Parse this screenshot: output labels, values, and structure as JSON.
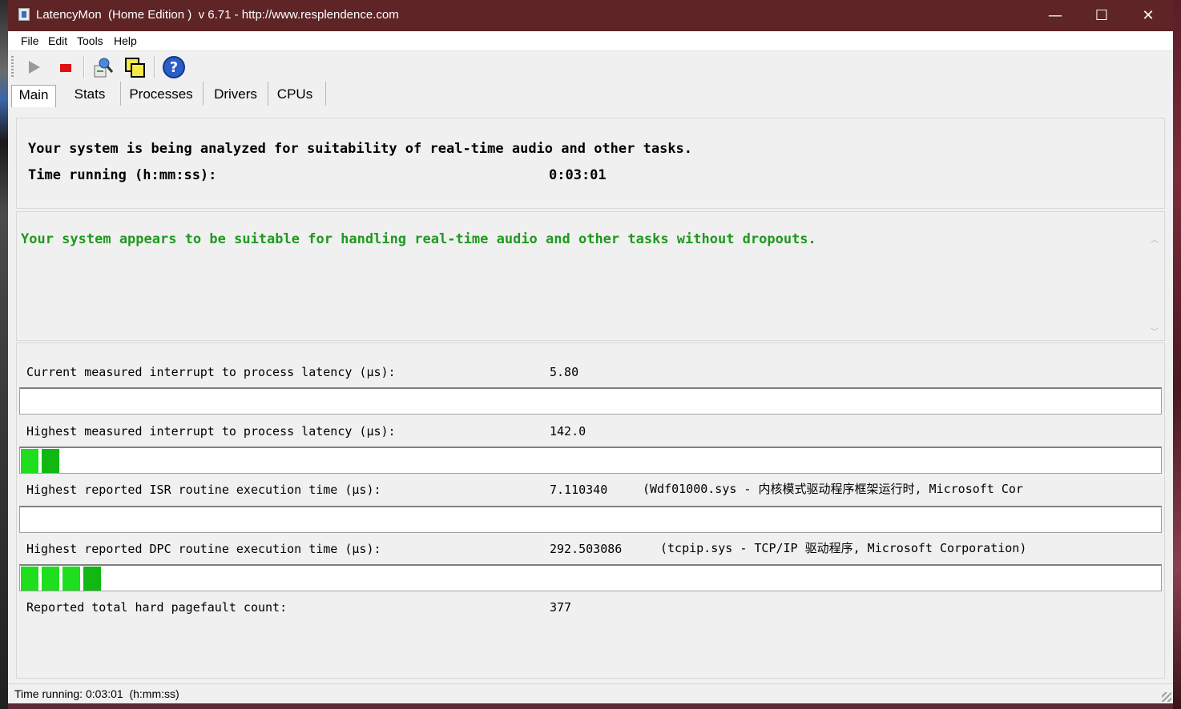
{
  "window": {
    "title": "LatencyMon  (Home Edition )  v 6.71 - http://www.resplendence.com",
    "minimize": "—",
    "maximize": "☐",
    "close": "✕"
  },
  "menu": [
    {
      "label": "File"
    },
    {
      "label": "Edit"
    },
    {
      "label": "Tools"
    },
    {
      "label": "Help"
    }
  ],
  "toolbar": {
    "icons": [
      "play-icon",
      "stop-icon",
      "report-icon",
      "windows-icon",
      "help-icon"
    ]
  },
  "tabs": [
    {
      "label": "Main",
      "active": true
    },
    {
      "label": "Stats"
    },
    {
      "label": "Processes"
    },
    {
      "label": "Drivers"
    },
    {
      "label": "CPUs"
    }
  ],
  "header": {
    "analyzing": "Your system is being analyzed for suitability of real-time audio and other tasks.",
    "time_label": "Time running (h:mm:ss):",
    "time_value": "0:03:01"
  },
  "verdict": {
    "text": "Your system appears to be suitable for handling real-time audio and other tasks without dropouts.",
    "color": "#1e9a1e"
  },
  "metrics": [
    {
      "label": "Current measured interrupt to process latency (µs):",
      "value": "5.80",
      "extra": "",
      "bar_segments": 0
    },
    {
      "label": "Highest measured interrupt to process latency (µs):",
      "value": "142.0",
      "extra": "",
      "bar_segments": 2
    },
    {
      "label": "Highest reported ISR routine execution time (µs):",
      "value": "7.110340",
      "extra": "(Wdf01000.sys - 内核模式驱动程序框架运行时, Microsoft Cor",
      "bar_segments": 0
    },
    {
      "label": "Highest reported DPC routine execution time (µs):",
      "value": "292.503086",
      "extra": "(tcpip.sys - TCP/IP 驱动程序, Microsoft Corporation)",
      "bar_segments": 4
    },
    {
      "label": "Reported total hard pagefault count:",
      "value": "377",
      "extra": ""
    }
  ],
  "status": {
    "text": "Time running: 0:03:01  (h:mm:ss)"
  },
  "colors": {
    "titlebar": "#5e2426",
    "bar_fill": "#1ede1e",
    "verdict_green": "#1e9a1e"
  }
}
